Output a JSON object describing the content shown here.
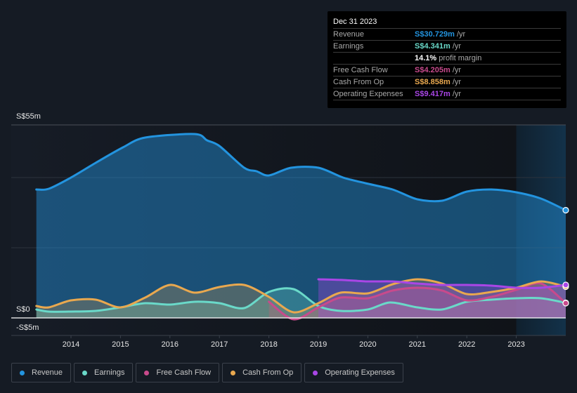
{
  "tooltip": {
    "date": "Dec 31 2023",
    "rows": [
      {
        "label": "Revenue",
        "value": "S$30.729m",
        "unit": " /yr",
        "color": "#2394df"
      },
      {
        "label": "Earnings",
        "value": "S$4.341m",
        "unit": " /yr",
        "color": "#6ad9c9"
      },
      {
        "label": "",
        "value": "14.1%",
        "unit": " profit margin",
        "color": "#ffffff"
      },
      {
        "label": "Free Cash Flow",
        "value": "S$4.205m",
        "unit": " /yr",
        "color": "#c84a8c"
      },
      {
        "label": "Cash From Op",
        "value": "S$8.858m",
        "unit": " /yr",
        "color": "#e9a84f"
      },
      {
        "label": "Operating Expenses",
        "value": "S$9.417m",
        "unit": " /yr",
        "color": "#a946e6"
      }
    ]
  },
  "legend": [
    {
      "label": "Revenue",
      "color": "#2394df"
    },
    {
      "label": "Earnings",
      "color": "#6ad9c9"
    },
    {
      "label": "Free Cash Flow",
      "color": "#c84a8c"
    },
    {
      "label": "Cash From Op",
      "color": "#e9a84f"
    },
    {
      "label": "Operating Expenses",
      "color": "#a946e6"
    }
  ],
  "chart_data": {
    "type": "area",
    "title": "",
    "xlabel": "",
    "ylabel": "",
    "y_unit": "S$ millions",
    "ylim": [
      -5,
      55
    ],
    "y_tick_labels": [
      {
        "value": 55,
        "label": "S$55m"
      },
      {
        "value": 0,
        "label": "S$0"
      },
      {
        "value": -5,
        "label": "-S$5m"
      }
    ],
    "y_gridlines": [
      55,
      40,
      20,
      0
    ],
    "xlim": [
      2013.3,
      2024.0
    ],
    "x_ticks": [
      2014,
      2015,
      2016,
      2017,
      2018,
      2019,
      2020,
      2021,
      2022,
      2023
    ],
    "highlight_range": [
      2023.0,
      2024.0
    ],
    "legend_position": "bottom-left",
    "series": [
      {
        "name": "Revenue",
        "color": "#2394df",
        "x": [
          2013.3,
          2013.55,
          2014.0,
          2014.5,
          2015.05,
          2015.5,
          2016.5,
          2016.75,
          2017.0,
          2017.5,
          2017.75,
          2018.0,
          2018.45,
          2019.0,
          2019.5,
          2019.95,
          2020.5,
          2021.0,
          2021.5,
          2022.0,
          2022.5,
          2023.0,
          2023.5,
          2024.0
        ],
        "values": [
          36.6,
          36.8,
          40.0,
          44.2,
          48.6,
          51.4,
          52.4,
          50.6,
          49.0,
          42.8,
          41.8,
          40.6,
          42.8,
          42.8,
          40.0,
          38.4,
          36.6,
          33.8,
          33.4,
          36.0,
          36.6,
          35.8,
          34.0,
          30.7
        ]
      },
      {
        "name": "Earnings",
        "color": "#6ad9c9",
        "x": [
          2013.3,
          2013.55,
          2014.0,
          2014.5,
          2015.0,
          2015.5,
          2016.0,
          2016.5,
          2017.0,
          2017.5,
          2018.0,
          2018.5,
          2019.0,
          2019.45,
          2020.0,
          2020.45,
          2021.0,
          2021.5,
          2022.0,
          2022.5,
          2023.0,
          2023.5,
          2024.0
        ],
        "values": [
          2.4,
          1.8,
          1.8,
          2.0,
          3.0,
          4.2,
          3.8,
          4.6,
          4.2,
          2.8,
          7.4,
          8.2,
          3.4,
          2.0,
          2.4,
          4.4,
          3.0,
          2.4,
          4.6,
          5.2,
          5.6,
          5.6,
          4.3
        ]
      },
      {
        "name": "Free Cash Flow",
        "color": "#c84a8c",
        "x": [
          2018.0,
          2018.5,
          2019.0,
          2019.45,
          2020.0,
          2020.5,
          2021.0,
          2021.5,
          2022.0,
          2022.5,
          2023.0,
          2023.5,
          2024.0
        ],
        "values": [
          4.6,
          -0.4,
          3.0,
          5.8,
          5.6,
          7.8,
          8.6,
          7.8,
          5.0,
          6.0,
          8.0,
          9.8,
          4.2
        ]
      },
      {
        "name": "Cash From Op",
        "color": "#e9a84f",
        "x": [
          2013.3,
          2013.55,
          2014.0,
          2014.5,
          2015.0,
          2015.5,
          2016.0,
          2016.5,
          2017.0,
          2017.5,
          2018.0,
          2018.5,
          2019.0,
          2019.45,
          2020.0,
          2020.5,
          2021.0,
          2021.5,
          2022.0,
          2022.5,
          2023.0,
          2023.5,
          2024.0
        ],
        "values": [
          3.4,
          3.0,
          5.0,
          5.2,
          3.0,
          5.8,
          9.4,
          7.2,
          8.8,
          9.4,
          6.0,
          1.6,
          4.2,
          7.2,
          7.0,
          9.6,
          11.0,
          9.8,
          6.8,
          7.4,
          8.6,
          10.4,
          8.9
        ]
      },
      {
        "name": "Operating Expenses",
        "color": "#a946e6",
        "x": [
          2019.0,
          2019.5,
          2020.0,
          2020.5,
          2021.0,
          2021.5,
          2022.0,
          2022.5,
          2023.0,
          2023.5,
          2024.0
        ],
        "values": [
          11.0,
          10.8,
          10.4,
          10.4,
          9.8,
          9.4,
          9.4,
          9.2,
          8.6,
          8.6,
          9.4
        ]
      }
    ]
  }
}
